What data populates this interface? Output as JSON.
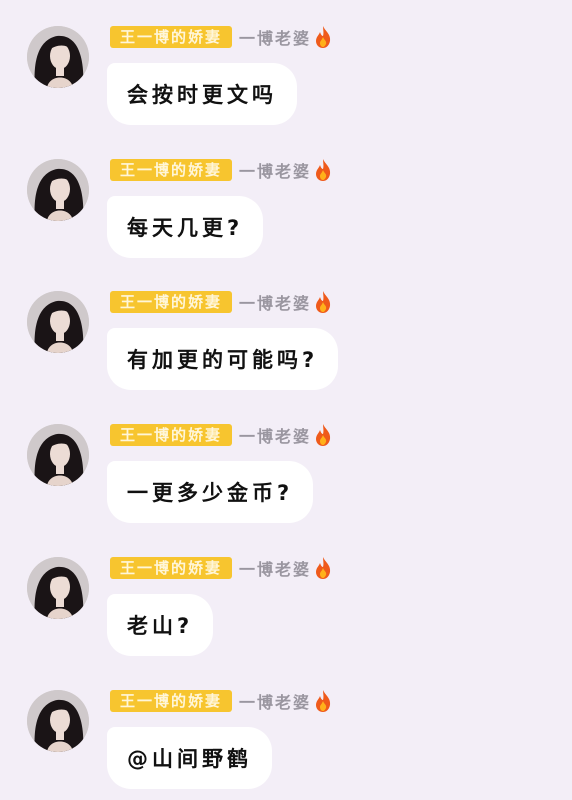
{
  "colors": {
    "background": "#f3eef7",
    "badge": "#f7c52f",
    "bubble": "#ffffff",
    "nickname": "#9a96a0"
  },
  "messages": [
    {
      "badge": "王一博的娇妻",
      "nickname": "一博老婆",
      "icon": "flame-icon",
      "text": "会按时更文吗"
    },
    {
      "badge": "王一博的娇妻",
      "nickname": "一博老婆",
      "icon": "flame-icon",
      "text": "每天几更?"
    },
    {
      "badge": "王一博的娇妻",
      "nickname": "一博老婆",
      "icon": "flame-icon",
      "text": "有加更的可能吗?"
    },
    {
      "badge": "王一博的娇妻",
      "nickname": "一博老婆",
      "icon": "flame-icon",
      "text": "一更多少金币?"
    },
    {
      "badge": "王一博的娇妻",
      "nickname": "一博老婆",
      "icon": "flame-icon",
      "text": "老山?"
    },
    {
      "badge": "王一博的娇妻",
      "nickname": "一博老婆",
      "icon": "flame-icon",
      "text": "@山间野鹤"
    }
  ]
}
